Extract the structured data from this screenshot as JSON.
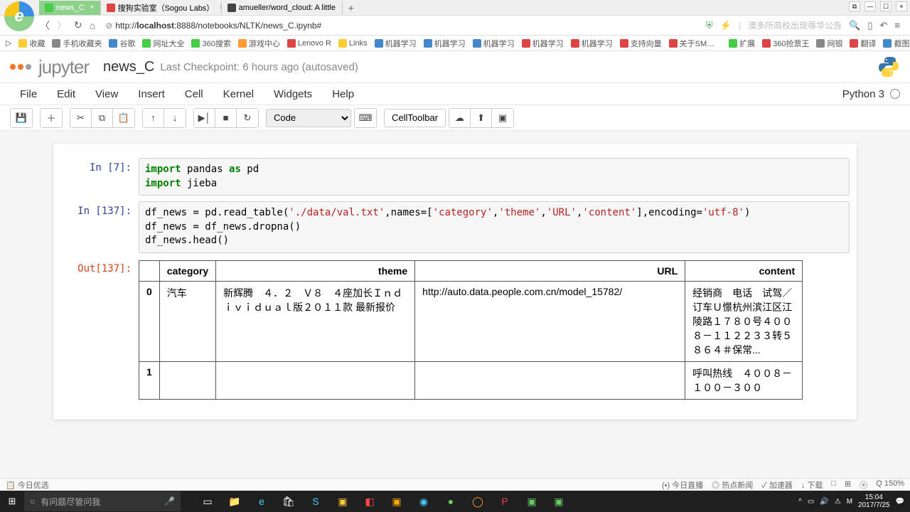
{
  "browser": {
    "tabs": [
      {
        "title": "news_C",
        "active": true
      },
      {
        "title": "搜狗实验室（Sogou Labs）",
        "active": false
      },
      {
        "title": "amueller/word_cloud: A little",
        "active": false
      }
    ],
    "url_host": "localhost",
    "url_rest": ":8888/notebooks/NLTK/news_C.ipynb#",
    "search_placeholder": "澳多所高校出现辱华公告"
  },
  "bookmarks": [
    "收藏",
    "手机收藏夹",
    "谷歌",
    "网址大全",
    "360搜索",
    "游戏中心",
    "Lenovo R",
    "Links",
    "机器学习",
    "机器学习",
    "机器学习",
    "机器学习",
    "机器学习",
    "支持向量",
    "关于SM…",
    "扩展",
    "360抢票王",
    "网银",
    "翻译",
    "截图"
  ],
  "jupyter": {
    "logo_text": "jupyter",
    "notebook_name": "news_C",
    "checkpoint": "Last Checkpoint: 6 hours ago (autosaved)",
    "menu": [
      "File",
      "Edit",
      "View",
      "Insert",
      "Cell",
      "Kernel",
      "Widgets",
      "Help"
    ],
    "kernel": "Python 3",
    "cell_type": "Code",
    "celltoolbar": "CellToolbar"
  },
  "cells": [
    {
      "type": "code",
      "prompt": "In [7]:",
      "lines": [
        {
          "t": "import",
          "k": true
        },
        {
          "t": " pandas "
        },
        {
          "t": "as",
          "k": true
        },
        {
          "t": " pd\n"
        },
        {
          "t": "import",
          "k": true
        },
        {
          "t": " jieba"
        }
      ]
    },
    {
      "type": "code",
      "prompt": "In [137]:",
      "lines": [
        {
          "t": "df_news = pd.read_table("
        },
        {
          "t": "'./data/val.txt'",
          "s": true
        },
        {
          "t": ",names=["
        },
        {
          "t": "'category'",
          "s": true
        },
        {
          "t": ","
        },
        {
          "t": "'theme'",
          "s": true
        },
        {
          "t": ","
        },
        {
          "t": "'URL'",
          "s": true
        },
        {
          "t": ","
        },
        {
          "t": "'content'",
          "s": true
        },
        {
          "t": "],encoding="
        },
        {
          "t": "'utf-8'",
          "s": true
        },
        {
          "t": ")\ndf_news = df_news.dropna()\ndf_news.head()"
        }
      ]
    }
  ],
  "output": {
    "prompt": "Out[137]:",
    "columns": [
      "",
      "category",
      "theme",
      "URL",
      "content"
    ],
    "rows": [
      {
        "idx": "0",
        "category": "汽车",
        "theme": "新辉腾　４．２　Ｖ８　４座加长Ｉｎｄｉｖｉｄｕａｌ版２０１１款 最新报价",
        "url": "http://auto.data.people.com.cn/model_15782/",
        "content": "经销商　电话　试驾／订车Ｕ憬杭州滨江区江陵路１７８０号４００８－１１２２３３转５８６４＃保常..."
      },
      {
        "idx": "1",
        "category": "",
        "theme": "",
        "url": "",
        "content": "呼叫热线　４００８－１００－３００"
      }
    ]
  },
  "statusbar": {
    "left": "今日优选",
    "items": [
      "今日直播",
      "热点新闻",
      "↓",
      "加速器",
      "下载",
      "",
      "",
      "ⓔ",
      "Q 150%"
    ]
  },
  "taskbar": {
    "search_placeholder": "有问题尽管问我",
    "time": "15:04",
    "date": "2017/7/25"
  },
  "chart_data": {
    "type": "table",
    "title": "df_news.head()",
    "columns": [
      "category",
      "theme",
      "URL",
      "content"
    ],
    "rows": [
      {
        "index": 0,
        "category": "汽车",
        "theme": "新辉腾 4.2 V8 4座加长Individual版2011款 最新报价",
        "URL": "http://auto.data.people.com.cn/model_15782/",
        "content": "经销商 电话 试驾/订车U憬杭州滨江区江陵路1780号4008-112233转5864#保常..."
      },
      {
        "index": 1,
        "category": "",
        "theme": "",
        "URL": "",
        "content": "呼叫热线 4008-100-300"
      }
    ]
  }
}
